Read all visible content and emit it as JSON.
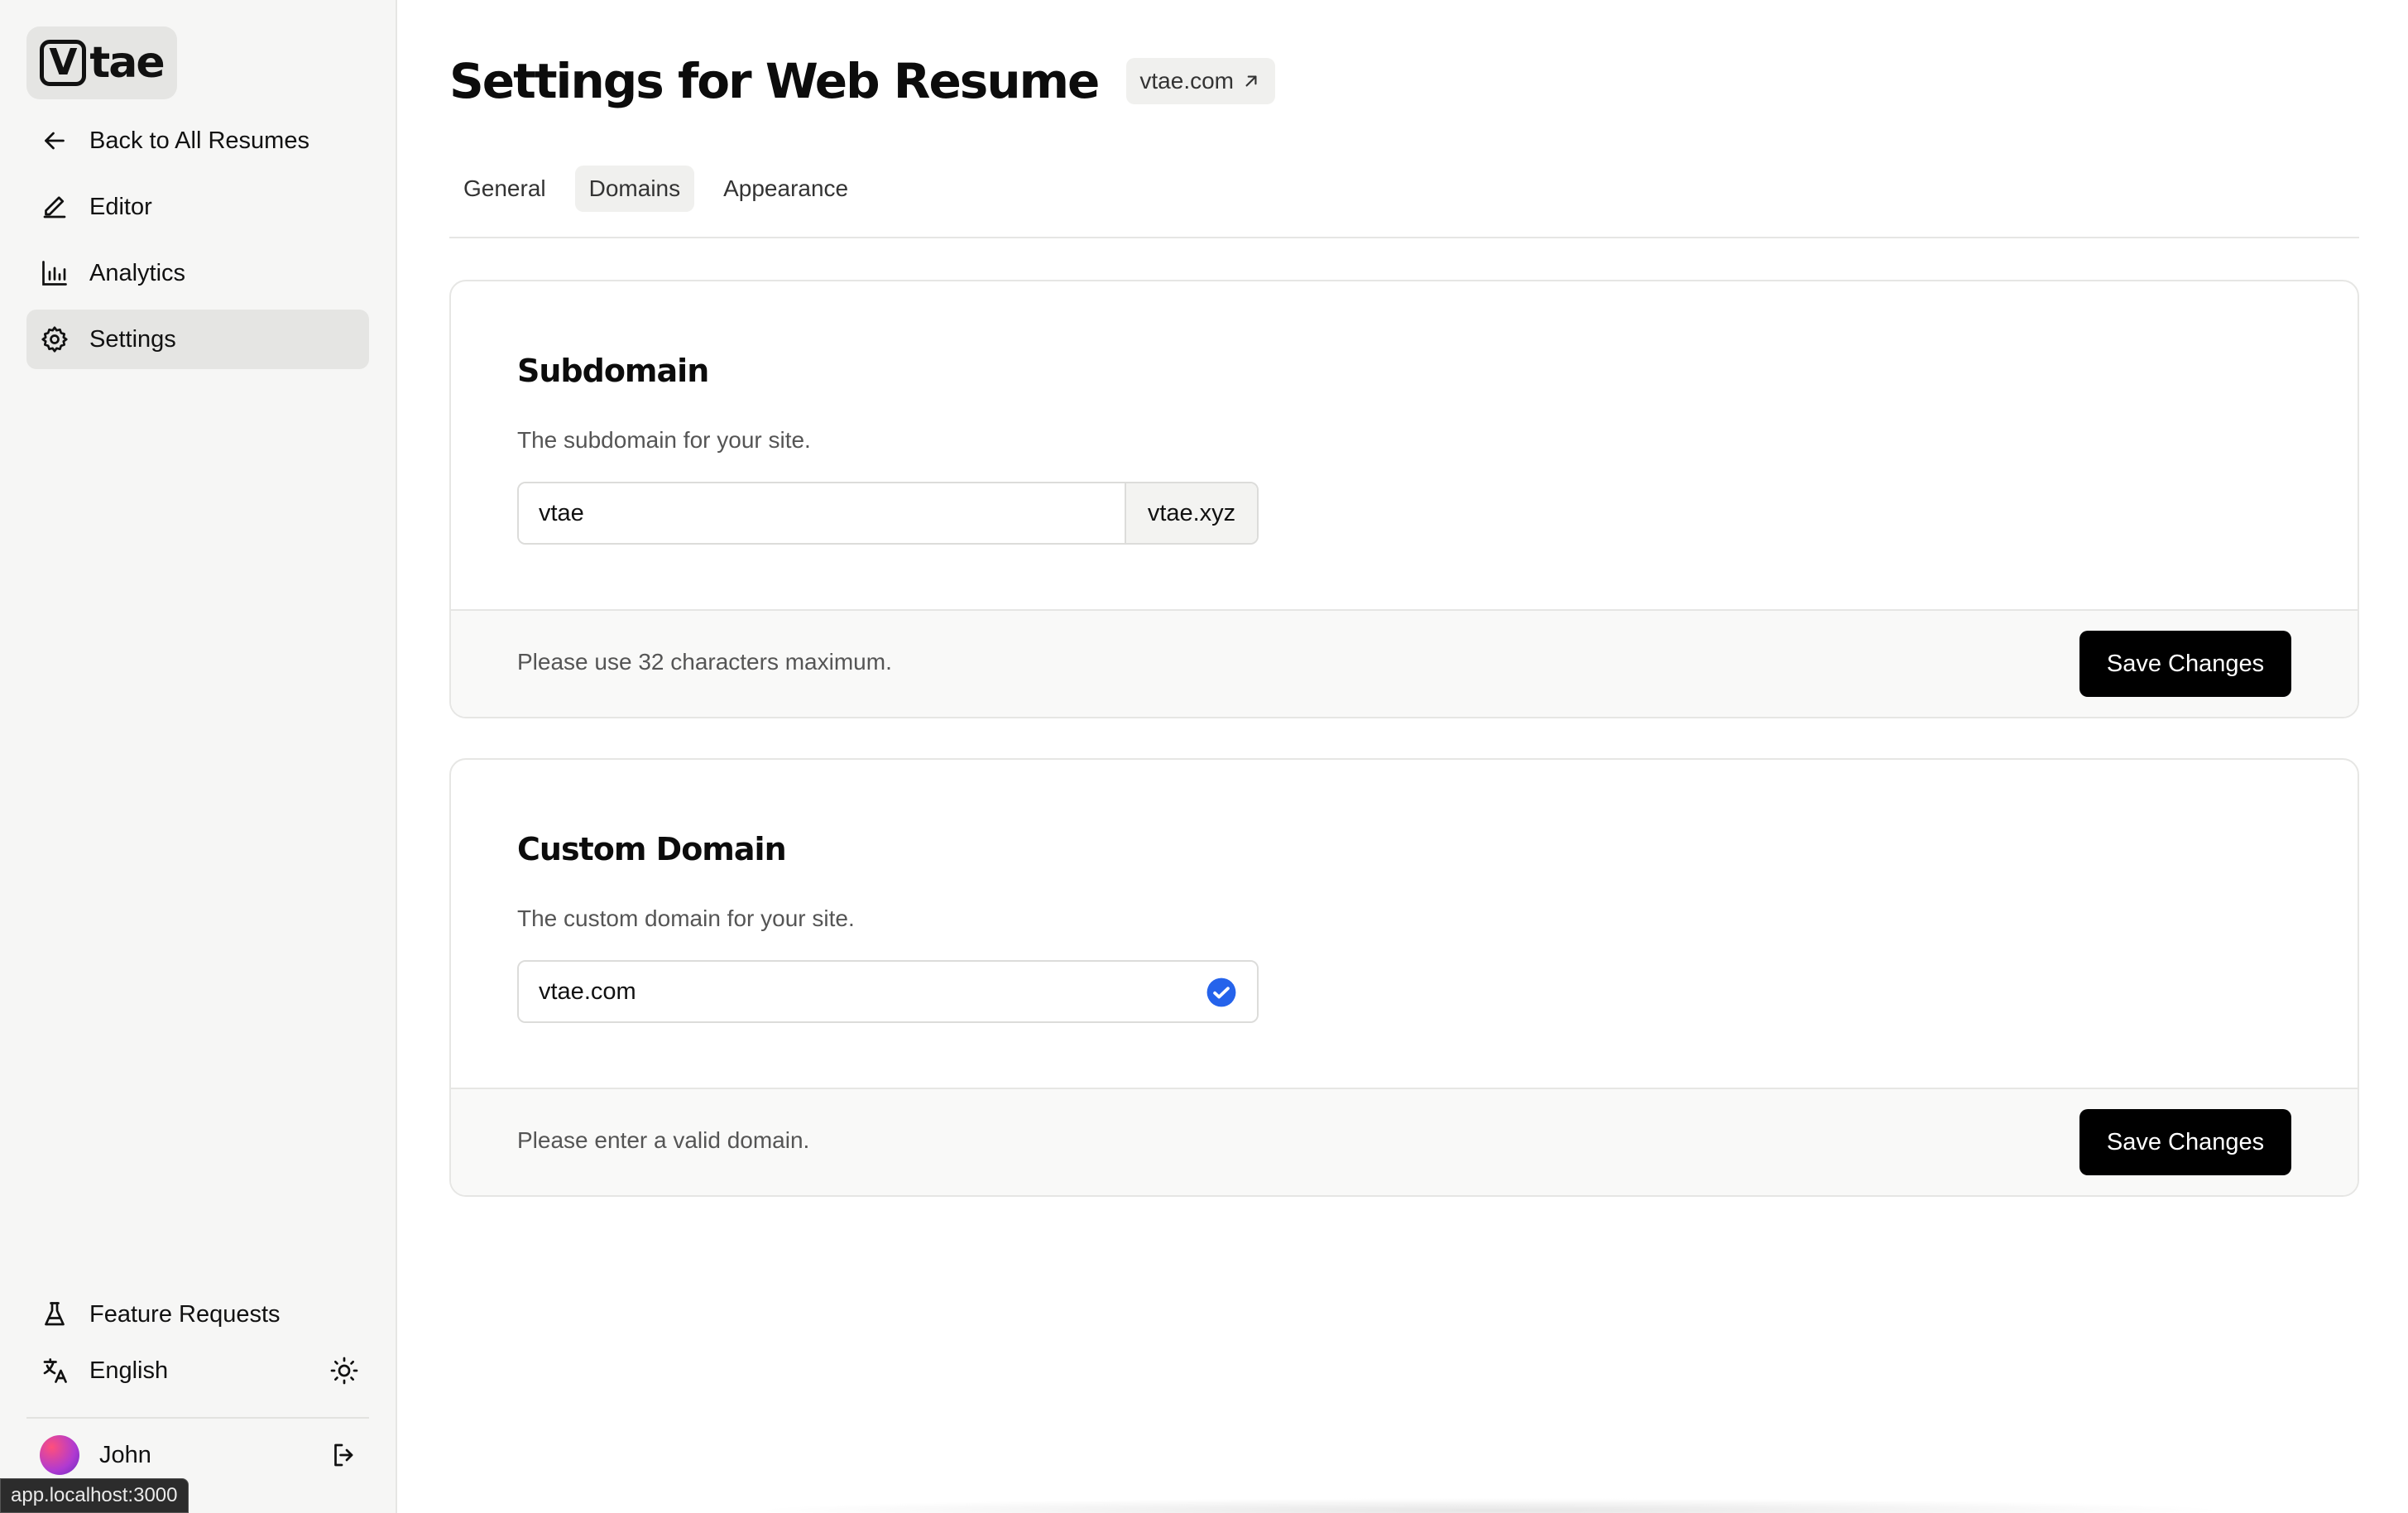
{
  "brand": {
    "logo_mark": "V",
    "logo_text": "tae"
  },
  "sidebar": {
    "items": [
      {
        "label": "Back to All Resumes",
        "icon": "arrow-left-icon"
      },
      {
        "label": "Editor",
        "icon": "pencil-icon"
      },
      {
        "label": "Analytics",
        "icon": "bar-chart-icon"
      },
      {
        "label": "Settings",
        "icon": "gear-icon",
        "active": true
      }
    ],
    "bottom": {
      "feature_requests": "Feature Requests",
      "language": "English"
    },
    "user": {
      "name": "John"
    }
  },
  "status_url": "app.localhost:3000",
  "header": {
    "title": "Settings for Web Resume",
    "domain_link": "vtae.com"
  },
  "tabs": [
    {
      "label": "General"
    },
    {
      "label": "Domains",
      "active": true
    },
    {
      "label": "Appearance"
    }
  ],
  "subdomain": {
    "title": "Subdomain",
    "description": "The subdomain for your site.",
    "value": "vtae",
    "suffix": "vtae.xyz",
    "note": "Please use 32 characters maximum.",
    "save_label": "Save Changes"
  },
  "custom_domain": {
    "title": "Custom Domain",
    "description": "The custom domain for your site.",
    "value": "vtae.com",
    "verified_icon": "check-circle-icon",
    "note": "Please enter a valid domain.",
    "save_label": "Save Changes"
  },
  "colors": {
    "accent": "#2563eb",
    "button": "#000000",
    "sidebar_bg": "#f6f6f5"
  }
}
